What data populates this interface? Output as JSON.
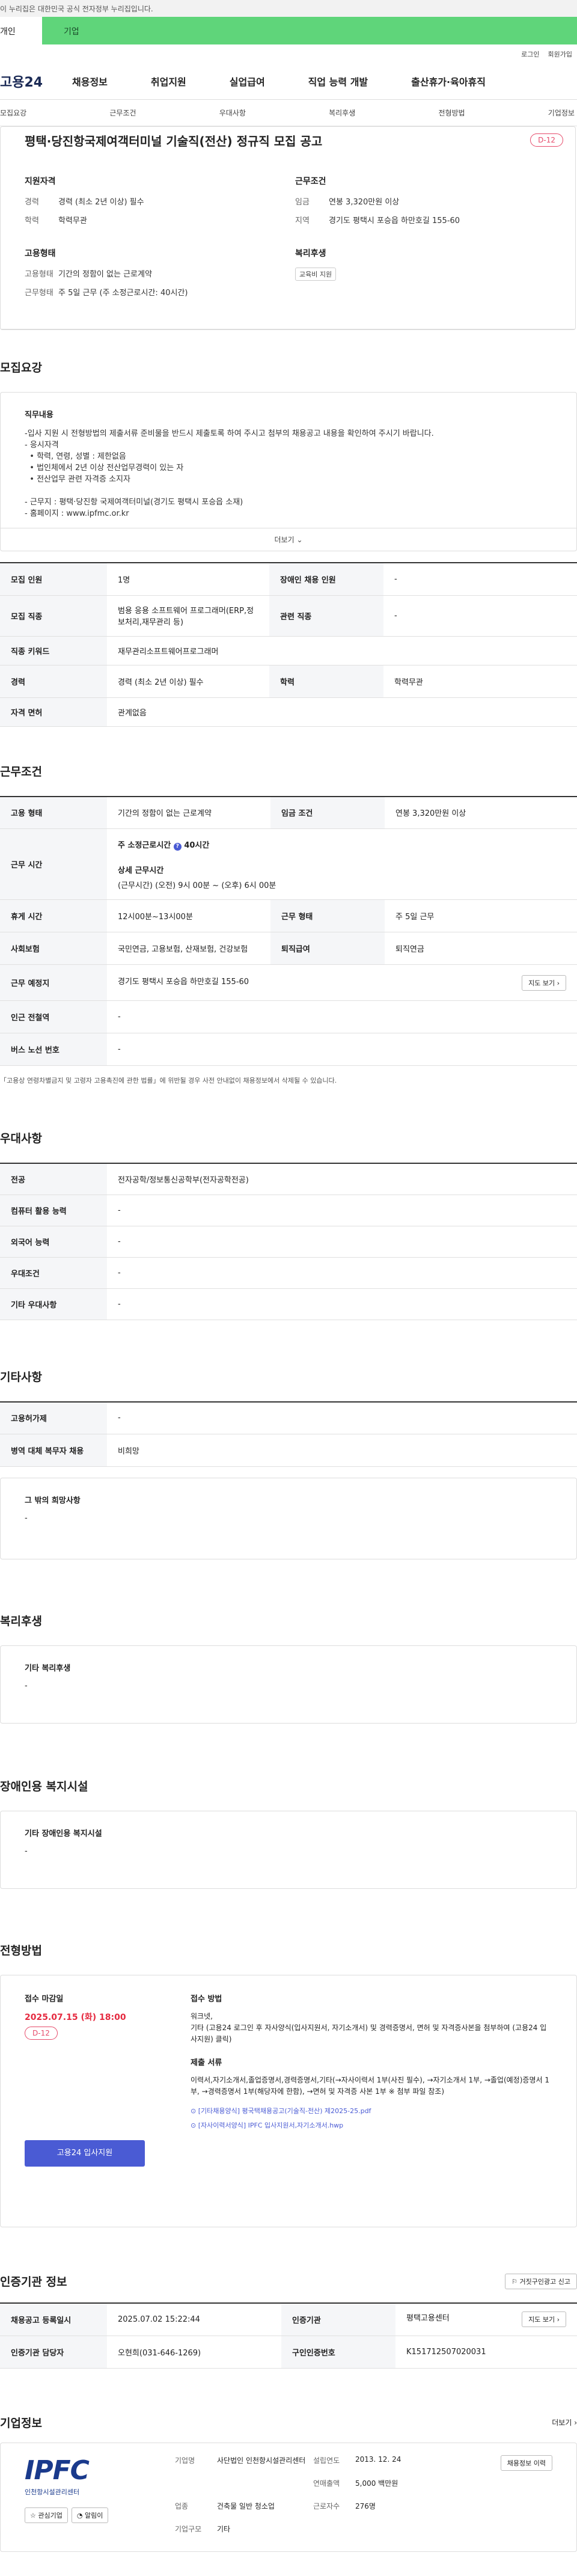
{
  "gov_bar": "이 누리집은 대한민국 공식 전자정부 누리집입니다.",
  "tabs": {
    "person": "개인",
    "company": "기업"
  },
  "util": {
    "login": "로그인",
    "join": "회원가입"
  },
  "gnb": {
    "logo": "고용24",
    "items": [
      "채용정보",
      "취업지원",
      "실업급여",
      "직업 능력 개발",
      "출산휴가·육아휴직"
    ]
  },
  "subnav": [
    "모집요강",
    "근무조건",
    "우대사항",
    "복리후생",
    "전형방법",
    "기업정보"
  ],
  "job": {
    "title": "평택·당진항국제여객터미널 기술직(전산) 정규직 모집 공고",
    "dday": "D-12",
    "qual_title": "지원자격",
    "qual": [
      {
        "k": "경력",
        "v": "경력 (최소 2년 이상) 필수"
      },
      {
        "k": "학력",
        "v": "학력무관"
      }
    ],
    "emp_title": "고용형태",
    "emp": [
      {
        "k": "고용형태",
        "v": "기간의 정함이 없는 근로계약"
      },
      {
        "k": "근무형태",
        "v": "주 5일 근무 (주 소정근로시간: 40시간)"
      }
    ],
    "cond_title": "근무조건",
    "cond": [
      {
        "k": "임금",
        "v": "연봉 3,320만원 이상"
      },
      {
        "k": "지역",
        "v": "경기도 평택시 포승읍 하만호길 155-60"
      }
    ],
    "welfare_title": "복리후생",
    "welfare_chip": "교육비 지원"
  },
  "recruit": {
    "section": "모집요강",
    "duty_title": "직무내용",
    "lines": [
      "-입사 지원 시 전형방법의 제출서류 준비물을 반드시 제출토록 하여 주시고 첨부의 채용공고 내용을 확인하여 주시기 바랍니다.",
      "- 응시자격",
      "  • 학력, 연령, 성별 : 제한없음",
      "  • 법인체에서 2년 이상 전산업무경력이 있는 자",
      "  • 전산업무 관련 자격증 소지자",
      "",
      "- 근무지 : 평택·당진항 국제여객터미널(경기도 평택시 포승읍 소재)",
      "- 홈페이지 : www.ipfmc.or.kr"
    ],
    "more": "더보기",
    "table": [
      [
        "모집 인원",
        "1명",
        "장애인 채용 인원",
        "-"
      ],
      [
        "모집 직종",
        "범용 응용 소프트웨어 프로그래머(ERP,정보처리,재무관리 등)",
        "관련 직종",
        "-"
      ],
      [
        "직종 키워드",
        "재무관리소프트웨어프로그래머",
        "",
        ""
      ],
      [
        "경력",
        "경력 (최소 2년 이상) 필수",
        "학력",
        "학력무관"
      ],
      [
        "자격 면허",
        "관계없음",
        "",
        ""
      ]
    ]
  },
  "work": {
    "section": "근무조건",
    "emp_type_k": "고용 형태",
    "emp_type_v": "기간의 정함이 없는 근로계약",
    "wage_k": "임금 조건",
    "wage_v": "연봉 3,320만원 이상",
    "hours_k": "근무 시간",
    "hours_v1": "주 소정근로시간",
    "hours_v2": "40시간",
    "hours_detail_t": "상세 근무시간",
    "hours_detail": "(근무시간) (오전) 9시 00분 ~ (오후) 6시 00분",
    "break_k": "휴게 시간",
    "break_v": "12시00분~13시00분",
    "form_k": "근무 형태",
    "form_v": "주 5일 근무",
    "ins_k": "사회보험",
    "ins_v": "국민연금, 고용보험, 산재보험, 건강보험",
    "ret_k": "퇴직급여",
    "ret_v": "퇴직연금",
    "place_k": "근무 예정지",
    "place_v": "경기도 평택시 포승읍 하만호길 155-60",
    "map": "지도 보기",
    "sub_k": "인근 전철역",
    "sub_v": "-",
    "bus_k": "버스 노선 번호",
    "bus_v": "-",
    "note": "「고용상 연령차별금지 및 고령자 고용촉진에 관한 법률」에 위반될 경우 사전 안내없이 채용정보에서 삭제될 수 있습니다."
  },
  "pref": {
    "section": "우대사항",
    "rows": [
      [
        "전공",
        "전자공학/정보통신공학부(전자공학전공)"
      ],
      [
        "컴퓨터 활용 능력",
        "-"
      ],
      [
        "외국어 능력",
        "-"
      ],
      [
        "우대조건",
        "-"
      ],
      [
        "기타 우대사항",
        "-"
      ]
    ]
  },
  "etc": {
    "section": "기타사항",
    "rows": [
      [
        "고용허가제",
        "-"
      ],
      [
        "병역 대체 복무자 채용",
        "비희망"
      ]
    ],
    "other_title": "그 밖의 희망사항",
    "other_v": "-"
  },
  "welfare": {
    "section": "복리후생",
    "title": "기타 복리후생",
    "v": "-"
  },
  "disabled": {
    "section": "장애인용 복지시설",
    "title": "기타 장애인용 복지시설",
    "v": "-"
  },
  "select": {
    "section": "전형방법",
    "deadline_t": "접수 마감일",
    "deadline": "2025.07.15 (화) 18:00",
    "dday": "D-12",
    "apply_btn": "고용24 입사지원",
    "method_t": "접수 방법",
    "method_1": "워크넷,",
    "method_2": "기타 (고용24 로그인 후 자사양식(입사지원서, 자기소개서) 및 경력증명서, 면허 및 자격증사본을 첨부하여 (고용24 입사지원) 클릭)",
    "docs_t": "제출 서류",
    "docs": "이력서,자기소개서,졸업증명서,경력증명서,기타(→자사이력서 1부(사진 필수), →자기소개서 1부, →졸업(예정)증명서 1부, →경력증명서 1부(해당자에 한함), →면허 및 자격증 사본 1부 ※ 첨부 파일 참조)",
    "file1": "[기타채용양식] 평국택채용공고(기술직-전산) 제2025-25.pdf",
    "file2": "[자사이력서양식] IPFC 입사지원서,자기소개서.hwp"
  },
  "agency": {
    "section": "인증기관 정보",
    "report": "거짓구인광고 신고",
    "rows": [
      [
        "채용공고 등록일시",
        "2025.07.02 15:22:44",
        "인증기관",
        "평택고용센터"
      ],
      [
        "인증기관 담당자",
        "오현희(031-646-1269)",
        "구인인증번호",
        "K151712507020031"
      ]
    ],
    "map": "지도 보기"
  },
  "company": {
    "section": "기업정보",
    "more": "더보기",
    "logo": "IPFC",
    "logo_sub": "인천항시설관리센터",
    "interest": "관심기업",
    "alarm": "알림이",
    "name_k": "기업명",
    "name_v": "사단법인 인천항시설관리센터",
    "year_k": "설립연도",
    "year_v": "2013. 12. 24",
    "sales_k": "연매출액",
    "sales_v": "5,000 백만원",
    "ind_k": "업종",
    "ind_v": "건축물 일반 청소업",
    "emp_k": "근로자수",
    "emp_v": "276명",
    "type_k": "기업구모",
    "type_v": "기타",
    "job_btn": "채용정보 이력"
  }
}
